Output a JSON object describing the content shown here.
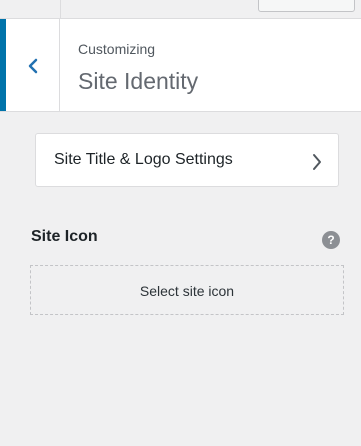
{
  "header": {
    "breadcrumb": "Customizing",
    "title": "Site Identity",
    "accent_color": "#0073aa",
    "back_icon": "chevron-left-icon"
  },
  "subsection": {
    "label": "Site Title & Logo Settings",
    "icon": "chevron-right-icon"
  },
  "site_icon": {
    "title": "Site Icon",
    "help_icon": "question-mark-icon",
    "help_glyph": "?",
    "select_label": "Select site icon"
  }
}
